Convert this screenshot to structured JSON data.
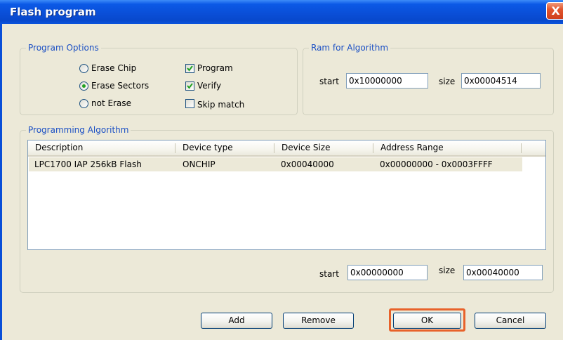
{
  "window": {
    "title": "Flash program",
    "close_glyph": "X"
  },
  "program_options": {
    "legend": "Program Options",
    "radios": [
      {
        "label": "Erase Chip",
        "selected": false
      },
      {
        "label": "Erase Sectors",
        "selected": true
      },
      {
        "label": "not Erase",
        "selected": false
      }
    ],
    "checkboxes": [
      {
        "label": "Program",
        "checked": true
      },
      {
        "label": "Verify",
        "checked": true
      },
      {
        "label": "Skip match",
        "checked": false
      }
    ]
  },
  "ram": {
    "legend": "Ram for Algorithm",
    "start_label": "start",
    "start_value": "0x10000000",
    "size_label": "size",
    "size_value": "0x00004514"
  },
  "algorithm": {
    "legend": "Programming Algorithm",
    "columns": [
      "Description",
      "Device type",
      "Device Size",
      "Address Range"
    ],
    "rows": [
      {
        "description": "LPC1700 IAP 256kB Flash",
        "device_type": "ONCHIP",
        "device_size": "0x00040000",
        "address_range": "0x00000000 - 0x0003FFFF"
      }
    ],
    "start_label": "start",
    "start_value": "0x00000000",
    "size_label": "size",
    "size_value": "0x00040000"
  },
  "buttons": {
    "add": "Add",
    "remove": "Remove",
    "ok": "OK",
    "cancel": "Cancel"
  },
  "colors": {
    "highlight": "#e8622a",
    "title_bar": "#0a4fd8",
    "legend_text": "#1a4fc4"
  }
}
